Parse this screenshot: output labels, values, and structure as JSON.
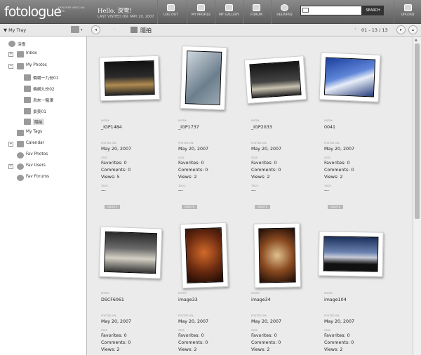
{
  "app": {
    "logo": "fotologue",
    "logo_sub": "EXPLORER VIEW 2.06 BETA",
    "greeting": "Hello, 深雪！",
    "last_visited": "LAST VISITED ON: MAY 20, 2007"
  },
  "toolbar": [
    {
      "label": "LOG OUT",
      "icon": "logout-icon"
    },
    {
      "label": "MY PROFILE",
      "icon": "profile-icon"
    },
    {
      "label": "MY GALLERY",
      "icon": "gallery-icon"
    },
    {
      "label": "FORUM",
      "icon": "forum-icon"
    },
    {
      "label": "HELP/FAQ",
      "icon": "help-icon"
    },
    {
      "label": "UPLOAD",
      "icon": "upload-icon"
    }
  ],
  "search": {
    "button": "SEARCH",
    "placeholder": ""
  },
  "tray": {
    "title": "My Tray"
  },
  "breadcrumb": "隨拍",
  "pager": "01 - 13 / 13",
  "sidebar": {
    "user": "深雪",
    "items": [
      {
        "label": "Inbox",
        "icon": "inbox-icon"
      },
      {
        "label": "My Photos",
        "icon": "photos-icon"
      },
      {
        "label": "僑楊一九份01",
        "icon": "folder-icon"
      },
      {
        "label": "僑網九份02",
        "icon": "folder-icon"
      },
      {
        "label": "烏來一賭澤",
        "icon": "folder-icon"
      },
      {
        "label": "景美01",
        "icon": "folder-icon"
      },
      {
        "label": "隨拍",
        "icon": "folder-icon"
      },
      {
        "label": "My Tags",
        "icon": "tag-icon"
      },
      {
        "label": "Calendar",
        "icon": "calendar-icon"
      },
      {
        "label": "Fav Photos",
        "icon": "fav-photos-icon"
      },
      {
        "label": "Fav Users",
        "icon": "fav-users-icon"
      },
      {
        "label": "Fav Forums",
        "icon": "fav-forums-icon"
      }
    ]
  },
  "labels": {
    "entry": "ENTRY:",
    "posted": "POSTED ON:",
    "stat": "STAT:",
    "tags": "TAGS:",
    "delete": "DELETE"
  },
  "photos": [
    {
      "name": "_IGP1484",
      "date": "May 20, 2007",
      "favorites": "Favorites: 0",
      "comments": "Comments: 0",
      "views": "Views: 5",
      "tags": "---"
    },
    {
      "name": "_IGP1737",
      "date": "May 20, 2007",
      "favorites": "Favorites: 0",
      "comments": "Comments: 0",
      "views": "Views: 2",
      "tags": "---"
    },
    {
      "name": "_IGP2033",
      "date": "May 20, 2007",
      "favorites": "Favorites: 0",
      "comments": "Comments: 0",
      "views": "Views: 2",
      "tags": "---"
    },
    {
      "name": "0041",
      "date": "May 20, 2007",
      "favorites": "Favorites: 0",
      "comments": "Comments: 0",
      "views": "Views: 2",
      "tags": "---"
    },
    {
      "name": "DSCF6061",
      "date": "May 20, 2007",
      "favorites": "Favorites: 0",
      "comments": "Comments: 0",
      "views": "Views: 2"
    },
    {
      "name": "image33",
      "date": "May 20, 2007",
      "favorites": "Favorites: 0",
      "comments": "Comments: 0",
      "views": "Views: 2"
    },
    {
      "name": "image34",
      "date": "May 20, 2007",
      "favorites": "Favorites: 0",
      "comments": "Comments: 0",
      "views": "Views: 2"
    },
    {
      "name": "image104",
      "date": "May 20, 2007",
      "favorites": "Favorites: 0",
      "comments": "Comments: 0",
      "views": "Views: 2"
    }
  ]
}
